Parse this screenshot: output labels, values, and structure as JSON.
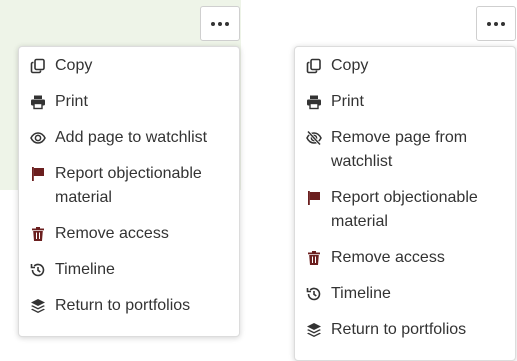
{
  "colors": {
    "icon": "#333333",
    "danger": "#6b1f1f",
    "panel_bg": "#eef4e8"
  },
  "left_menu": {
    "items": [
      {
        "label": "Copy",
        "icon": "copy-icon"
      },
      {
        "label": "Print",
        "icon": "print-icon"
      },
      {
        "label": "Add page to watchlist",
        "icon": "eye-icon"
      },
      {
        "label": "Report objectionable material",
        "icon": "flag-icon"
      },
      {
        "label": "Remove access",
        "icon": "trash-icon"
      },
      {
        "label": "Timeline",
        "icon": "history-icon"
      },
      {
        "label": "Return to portfolios",
        "icon": "layers-icon"
      }
    ]
  },
  "right_menu": {
    "items": [
      {
        "label": "Copy",
        "icon": "copy-icon"
      },
      {
        "label": "Print",
        "icon": "print-icon"
      },
      {
        "label": "Remove page from watchlist",
        "icon": "eye-slash-icon"
      },
      {
        "label": "Report objectionable material",
        "icon": "flag-icon"
      },
      {
        "label": "Remove access",
        "icon": "trash-icon"
      },
      {
        "label": "Timeline",
        "icon": "history-icon"
      },
      {
        "label": "Return to portfolios",
        "icon": "layers-icon"
      }
    ]
  }
}
